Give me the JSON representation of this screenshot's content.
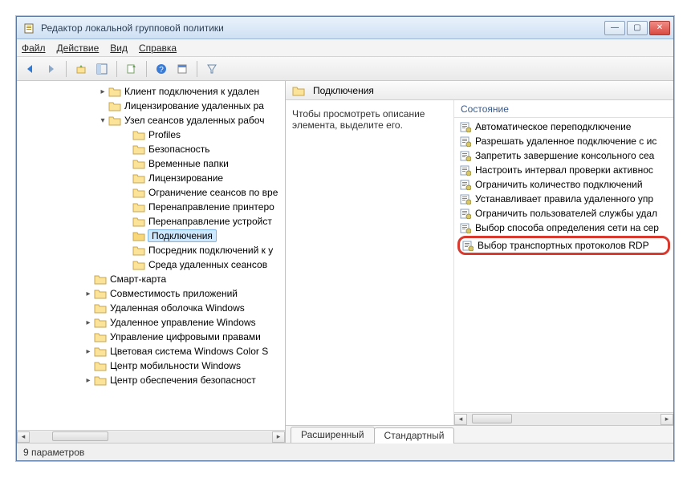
{
  "title": "Редактор локальной групповой политики",
  "menu": {
    "file": "Файл",
    "action": "Действие",
    "view": "Вид",
    "help": "Справка"
  },
  "tree": {
    "items": [
      {
        "indent": 100,
        "twisty": "▸",
        "label": "Клиент подключения к удален"
      },
      {
        "indent": 100,
        "twisty": "",
        "label": "Лицензирование удаленных ра"
      },
      {
        "indent": 100,
        "twisty": "▾",
        "label": "Узел сеансов удаленных рабоч"
      },
      {
        "indent": 130,
        "twisty": "",
        "label": "Profiles"
      },
      {
        "indent": 130,
        "twisty": "",
        "label": "Безопасность"
      },
      {
        "indent": 130,
        "twisty": "",
        "label": "Временные папки"
      },
      {
        "indent": 130,
        "twisty": "",
        "label": "Лицензирование"
      },
      {
        "indent": 130,
        "twisty": "",
        "label": "Ограничение сеансов по вре"
      },
      {
        "indent": 130,
        "twisty": "",
        "label": "Перенаправление принтеро"
      },
      {
        "indent": 130,
        "twisty": "",
        "label": "Перенаправление устройст"
      },
      {
        "indent": 130,
        "twisty": "",
        "label": "Подключения",
        "selected": true
      },
      {
        "indent": 130,
        "twisty": "",
        "label": "Посредник подключений к у"
      },
      {
        "indent": 130,
        "twisty": "",
        "label": "Среда удаленных сеансов"
      },
      {
        "indent": 82,
        "twisty": "",
        "label": "Смарт-карта"
      },
      {
        "indent": 82,
        "twisty": "▸",
        "label": "Совместимость приложений"
      },
      {
        "indent": 82,
        "twisty": "",
        "label": "Удаленная оболочка Windows"
      },
      {
        "indent": 82,
        "twisty": "▸",
        "label": "Удаленное управление Windows"
      },
      {
        "indent": 82,
        "twisty": "",
        "label": "Управление цифровыми правами"
      },
      {
        "indent": 82,
        "twisty": "▸",
        "label": "Цветовая система Windows Color S"
      },
      {
        "indent": 82,
        "twisty": "",
        "label": "Центр мобильности Windows"
      },
      {
        "indent": 82,
        "twisty": "▸",
        "label": "Центр обеспечения безопасност"
      }
    ]
  },
  "details": {
    "heading": "Подключения",
    "description": "Чтобы просмотреть описание элемента, выделите его.",
    "column_header": "Состояние",
    "settings": [
      "Автоматическое переподключение",
      "Разрешать удаленное подключение с ис",
      "Запретить завершение консольного сеа",
      "Настроить интервал проверки активнос",
      "Ограничить количество подключений",
      "Устанавливает правила удаленного упр",
      "Ограничить пользователей службы удал",
      "Выбор способа определения сети на сер",
      "Выбор транспортных протоколов RDP"
    ],
    "highlighted_index": 8
  },
  "tabs": {
    "extended": "Расширенный",
    "standard": "Стандартный"
  },
  "status": "9 параметров"
}
